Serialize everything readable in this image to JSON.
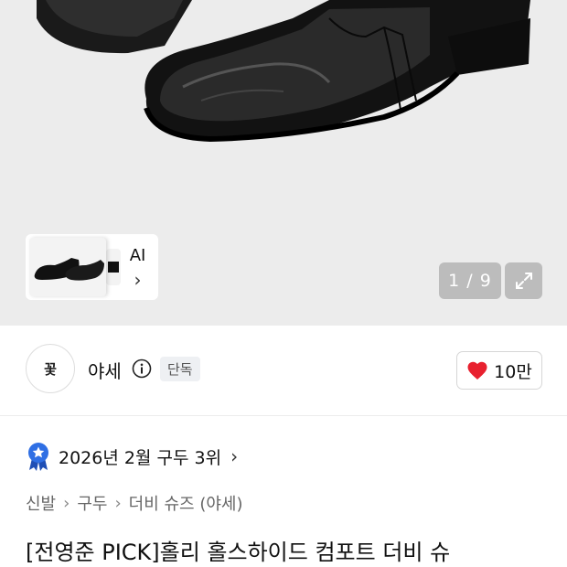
{
  "gallery": {
    "ai_label": "AI",
    "ai_chevron": "›",
    "counter": "1 / 9"
  },
  "brand": {
    "logo_text": "꽃",
    "name": "야세",
    "badge": "단독",
    "like_count": "10만"
  },
  "ranking": {
    "text": "2026년 2월 구두 3위",
    "chevron": "›"
  },
  "breadcrumb": {
    "items": [
      "신발",
      "구두",
      "더비 슈즈 (야세)"
    ],
    "sep": "›"
  },
  "product": {
    "title": "[전영준 PICK]홀리 홀스하이드 컴포트 더비 슈"
  },
  "colors": {
    "heart": "#e8212f",
    "rank_badge": "#2f6fe4"
  },
  "icons": [
    "expand-icon",
    "info-icon",
    "heart-icon",
    "rank-badge-icon",
    "chevron-right-icon"
  ]
}
